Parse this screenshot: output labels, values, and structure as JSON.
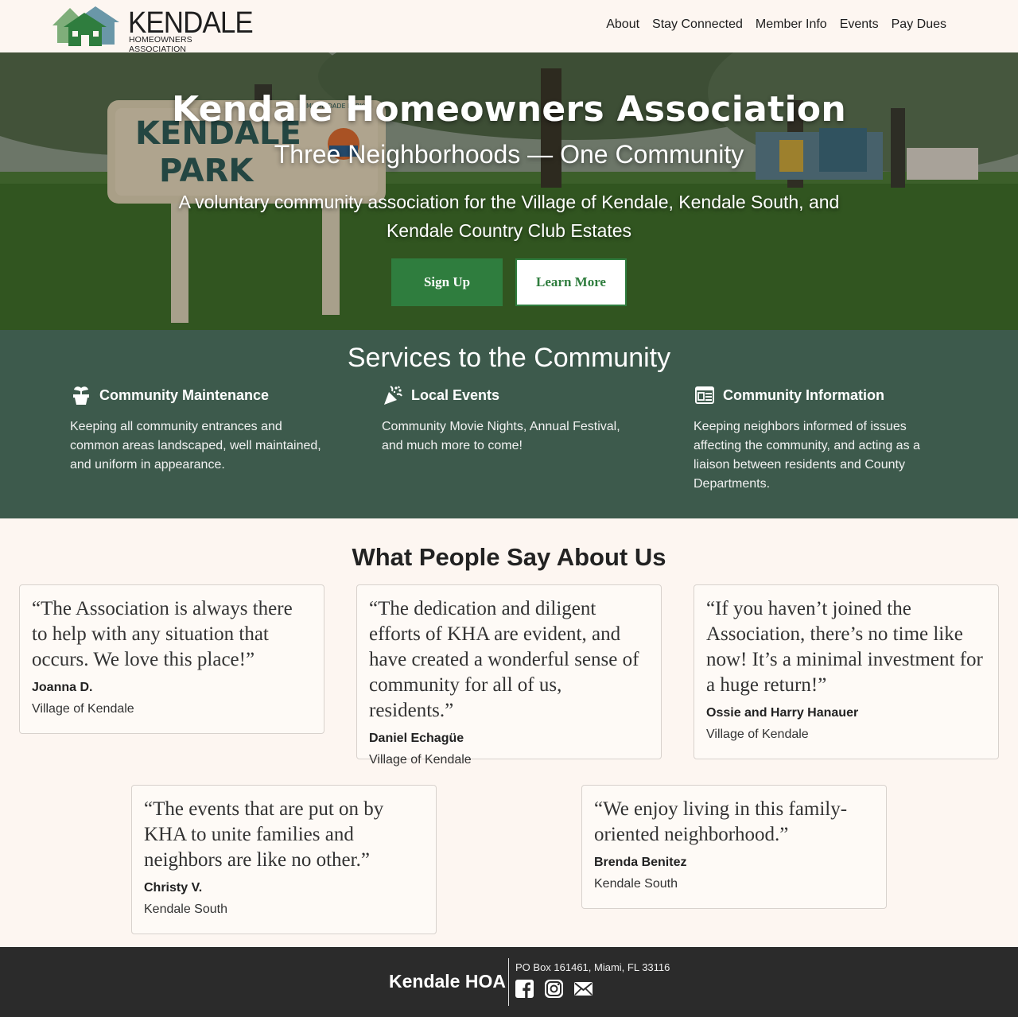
{
  "nav": {
    "logo_word": "KENDALE",
    "logo_sub": "HOMEOWNERS ASSOCIATION",
    "items": [
      "About",
      "Stay Connected",
      "Member Info",
      "Events",
      "Pay Dues"
    ]
  },
  "hero": {
    "title": "Kendale Homeowners Association",
    "subtitle": "Three Neighborhoods — One Community",
    "description": "A voluntary community association for the Village of Kendale, Kendale South, and Kendale Country Club Estates",
    "sign_up": "Sign Up",
    "learn_more": "Learn More",
    "sign_text_1": "KENDALE",
    "sign_text_2": "PARK",
    "sign_small": "MIAMI-DADE PARKS"
  },
  "services": {
    "title": "Services to the Community",
    "items": [
      {
        "icon": "plant-pot-icon",
        "title": "Community Maintenance",
        "text": "Keeping all community entrances and common areas landscaped, well maintained, and uniform in appearance."
      },
      {
        "icon": "party-popper-icon",
        "title": "Local Events",
        "text": "Community Movie Nights, Annual Festival, and much more to come!"
      },
      {
        "icon": "newspaper-icon",
        "title": "Community Information",
        "text": "Keeping neighbors informed of issues affecting the community, and acting as a liaison between residents and County Departments."
      }
    ]
  },
  "testimonials": {
    "title": "What People Say About Us",
    "items": [
      {
        "quote": "“The Association is always there to help with any situation that occurs. We love this place!”",
        "author": "Joanna D.",
        "place": "Village of Kendale"
      },
      {
        "quote": "“The dedication and diligent efforts of KHA are evident, and have created a wonderful sense of community for all of us, residents.”",
        "author": "Daniel Echagüe",
        "place": "Village of Kendale"
      },
      {
        "quote": "“If you haven’t joined the Association, there’s no time like now! It’s a minimal investment for a huge return!”",
        "author": "Ossie and Harry Hanauer",
        "place": "Village of Kendale"
      },
      {
        "quote": "“The events that are put on by KHA to unite families and neighbors are like no other.”",
        "author": "Christy V.",
        "place": "Kendale South"
      },
      {
        "quote": "“We enjoy living in this family-oriented neighborhood.”",
        "author": "Brenda Benitez",
        "place": "Kendale South"
      }
    ]
  },
  "footer": {
    "brand": "Kendale HOA",
    "address": "PO Box 161461, Miami, FL 33116",
    "icons": [
      "facebook-icon",
      "instagram-icon",
      "email-icon"
    ]
  },
  "colors": {
    "primary_green": "#2f7d3e",
    "services_bg": "#3d5a4c",
    "page_bg": "#fdf6f1",
    "footer_bg": "#2b2b2b"
  }
}
